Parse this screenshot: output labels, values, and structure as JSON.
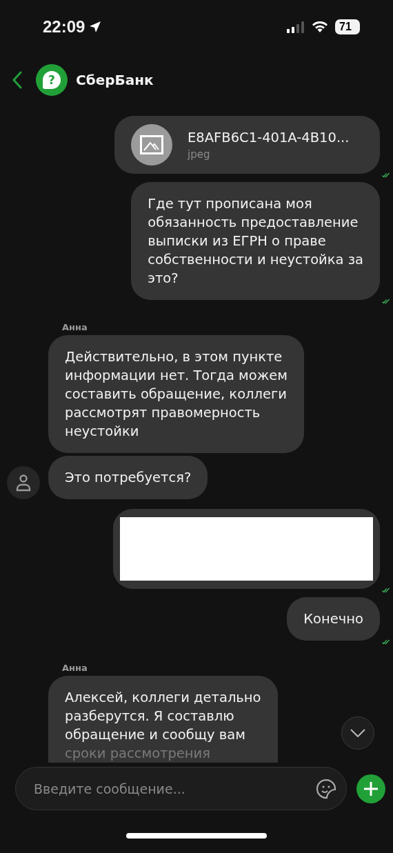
{
  "status_bar": {
    "time": "22:09",
    "battery": "71"
  },
  "header": {
    "title": "СберБанк",
    "avatar_glyph": "?"
  },
  "messages": [
    {
      "kind": "file",
      "outgoing": true,
      "name": "E8AFB6C1-401A-4B10...",
      "type": "jpeg"
    },
    {
      "kind": "text",
      "outgoing": true,
      "text": "Где тут прописана моя\nобязанность предоставление\nвыписки из ЕГРН о праве\nсобственности и неустойка за\nэто?"
    },
    {
      "kind": "sender",
      "outgoing": false,
      "name": "Анна"
    },
    {
      "kind": "text",
      "outgoing": false,
      "text": "Действительно, в этом пункте\nинформации нет. Тогда можем\nсоставить обращение, коллеги\nрассмотрят правомерность\nнеустойки"
    },
    {
      "kind": "text",
      "outgoing": false,
      "avatar": true,
      "text": "Это потребуется?"
    },
    {
      "kind": "redacted",
      "outgoing": true
    },
    {
      "kind": "text",
      "outgoing": true,
      "text": "Конечно"
    },
    {
      "kind": "sender",
      "outgoing": false,
      "name": "Анна"
    },
    {
      "kind": "text",
      "outgoing": false,
      "cut": true,
      "text": "Алексей, коллеги детально\nразберутся. Я составлю\nобращение и сообщу вам",
      "faded_line": "сроки рассмотрения"
    }
  ],
  "composer": {
    "placeholder": "Введите сообщение..."
  }
}
